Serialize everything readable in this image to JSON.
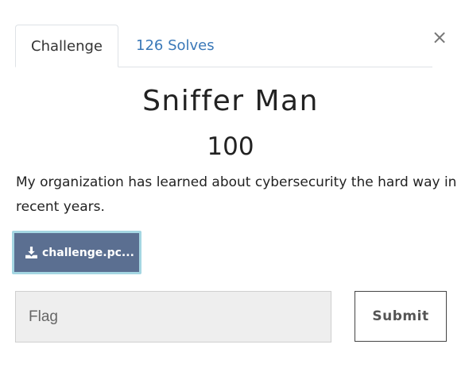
{
  "tabs": [
    {
      "label": "Challenge",
      "active": true
    },
    {
      "label": "126 Solves",
      "active": false
    }
  ],
  "close_label": "×",
  "challenge": {
    "name": "Sniffer Man",
    "value": "100",
    "description": "My organization has learned about cybersecurity the hard way in recent years.",
    "file_label": "challenge.pc..."
  },
  "form": {
    "flag_placeholder": "Flag",
    "flag_value": "",
    "submit_label": "Submit"
  },
  "colors": {
    "accent_link": "#3a78b8",
    "file_button_bg": "#5b6f91",
    "file_button_border": "#a4d6e2",
    "input_bg": "#eeeeee"
  },
  "icons": {
    "file": "download-icon",
    "close": "close-icon"
  }
}
